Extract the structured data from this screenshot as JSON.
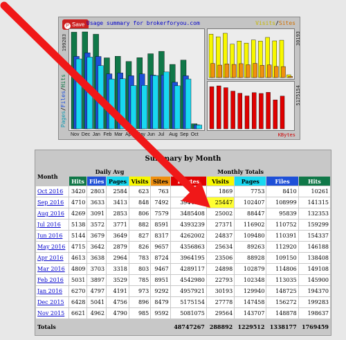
{
  "graph": {
    "save_label": "Save",
    "title": "Usage summary for brokerforyou.com",
    "visits_label": "Visits",
    "sites_label": "Sites",
    "slash": "/",
    "kbytes_label": "KBytes",
    "y_left": "199283",
    "y_right_top": "30193",
    "y_right_bottom": "5175154",
    "side_legend": {
      "pages": "Pages",
      "files": "Files",
      "hits": "Hits",
      "sep": "/"
    },
    "months": [
      "Nov",
      "Dec",
      "Jan",
      "Feb",
      "Mar",
      "Apr",
      "May",
      "Jun",
      "Jul",
      "Aug",
      "Sep",
      "Oct"
    ],
    "colors": {
      "hits": "#107848",
      "files": "#1e50d8",
      "pages": "#18d8f0",
      "visits": "#f8f800",
      "sites": "#f09010",
      "kbytes": "#e00000"
    }
  },
  "table": {
    "title": "Summary by Month",
    "month_label": "Month",
    "daily_avg_label": "Daily Avg",
    "monthly_totals_label": "Monthly Totals",
    "col_hits": "Hits",
    "col_files": "Files",
    "col_pages": "Pages",
    "col_visits": "Visits",
    "col_sites": "Sites",
    "col_kbytes": "KBytes",
    "totals_label": "Totals",
    "rows": [
      {
        "month": "Oct 2016",
        "d": [
          "3420",
          "2803",
          "2584",
          "623"
        ],
        "t": [
          "763",
          "",
          "1869",
          "7753",
          "8410",
          "10261"
        ]
      },
      {
        "month": "Sep 2016",
        "d": [
          "4710",
          "3633",
          "3413",
          "848"
        ],
        "t": [
          "7492",
          "3944358",
          "25447",
          "102407",
          "108999",
          "141315"
        ]
      },
      {
        "month": "Aug 2016",
        "d": [
          "4269",
          "3091",
          "2853",
          "806"
        ],
        "t": [
          "7579",
          "3485408",
          "25002",
          "88447",
          "95839",
          "132353"
        ]
      },
      {
        "month": "Jul 2016",
        "d": [
          "5138",
          "3572",
          "3771",
          "882"
        ],
        "t": [
          "8591",
          "4393239",
          "27371",
          "116902",
          "110752",
          "159299"
        ]
      },
      {
        "month": "Jun 2016",
        "d": [
          "5144",
          "3679",
          "3649",
          "827"
        ],
        "t": [
          "8317",
          "4262002",
          "24837",
          "109480",
          "110391",
          "154337"
        ]
      },
      {
        "month": "May 2016",
        "d": [
          "4715",
          "3642",
          "2879",
          "826"
        ],
        "t": [
          "9657",
          "4356863",
          "25634",
          "89263",
          "112920",
          "146188"
        ]
      },
      {
        "month": "Apr 2016",
        "d": [
          "4613",
          "3638",
          "2964",
          "783"
        ],
        "t": [
          "8724",
          "3964195",
          "23506",
          "88928",
          "109150",
          "138408"
        ]
      },
      {
        "month": "Mar 2016",
        "d": [
          "4809",
          "3703",
          "3318",
          "803"
        ],
        "t": [
          "9467",
          "4289117",
          "24898",
          "102879",
          "114806",
          "149108"
        ]
      },
      {
        "month": "Feb 2016",
        "d": [
          "5031",
          "3897",
          "3529",
          "785"
        ],
        "t": [
          "8951",
          "4542980",
          "22793",
          "102348",
          "113035",
          "145900"
        ]
      },
      {
        "month": "Jan 2016",
        "d": [
          "6270",
          "4797",
          "4191",
          "973"
        ],
        "t": [
          "9292",
          "4957921",
          "30193",
          "129940",
          "148725",
          "194370"
        ]
      },
      {
        "month": "Dec 2015",
        "d": [
          "6428",
          "5041",
          "4756",
          "896"
        ],
        "t": [
          "8479",
          "5175154",
          "27778",
          "147458",
          "156272",
          "199283"
        ]
      },
      {
        "month": "Nov 2015",
        "d": [
          "6621",
          "4962",
          "4790",
          "985"
        ],
        "t": [
          "9592",
          "5081075",
          "29564",
          "143707",
          "148878",
          "198637"
        ]
      }
    ],
    "totals": [
      "48747267",
      "288892",
      "1229512",
      "1338177",
      "1769459"
    ]
  },
  "chart_data": [
    {
      "type": "bar",
      "categories": [
        "Nov",
        "Dec",
        "Jan",
        "Feb",
        "Mar",
        "Apr",
        "May",
        "Jun",
        "Jul",
        "Aug",
        "Sep",
        "Oct"
      ],
      "series": [
        {
          "name": "Hits",
          "values": [
            198637,
            199283,
            194370,
            145900,
            149108,
            138408,
            146188,
            154337,
            159299,
            132353,
            141315,
            10261
          ]
        },
        {
          "name": "Files",
          "values": [
            148878,
            156272,
            148725,
            113035,
            114806,
            109150,
            112920,
            110391,
            110752,
            95839,
            108999,
            8410
          ]
        },
        {
          "name": "Pages",
          "values": [
            143707,
            147458,
            129940,
            102348,
            102879,
            88928,
            89263,
            109480,
            116902,
            88447,
            102407,
            7753
          ]
        }
      ],
      "ylim": [
        0,
        199283
      ]
    },
    {
      "type": "bar",
      "categories": [
        "Nov",
        "Dec",
        "Jan",
        "Feb",
        "Mar",
        "Apr",
        "May",
        "Jun",
        "Jul",
        "Aug",
        "Sep",
        "Oct"
      ],
      "series": [
        {
          "name": "Visits",
          "values": [
            29564,
            27778,
            30193,
            22793,
            24898,
            23506,
            25634,
            24837,
            27371,
            25002,
            25447,
            1869
          ]
        },
        {
          "name": "Sites",
          "values": [
            9592,
            8479,
            9292,
            8951,
            9467,
            8724,
            9657,
            8317,
            8591,
            7579,
            7492,
            763
          ]
        }
      ],
      "ylim": [
        0,
        30193
      ]
    },
    {
      "type": "bar",
      "categories": [
        "Nov",
        "Dec",
        "Jan",
        "Feb",
        "Mar",
        "Apr",
        "May",
        "Jun",
        "Jul",
        "Aug",
        "Sep",
        "Oct"
      ],
      "series": [
        {
          "name": "KBytes",
          "values": [
            5081075,
            5175154,
            4957921,
            4542980,
            4289117,
            3964195,
            4356863,
            4262002,
            4393239,
            3485408,
            3944358,
            0
          ]
        }
      ],
      "ylim": [
        0,
        5175154
      ]
    }
  ]
}
